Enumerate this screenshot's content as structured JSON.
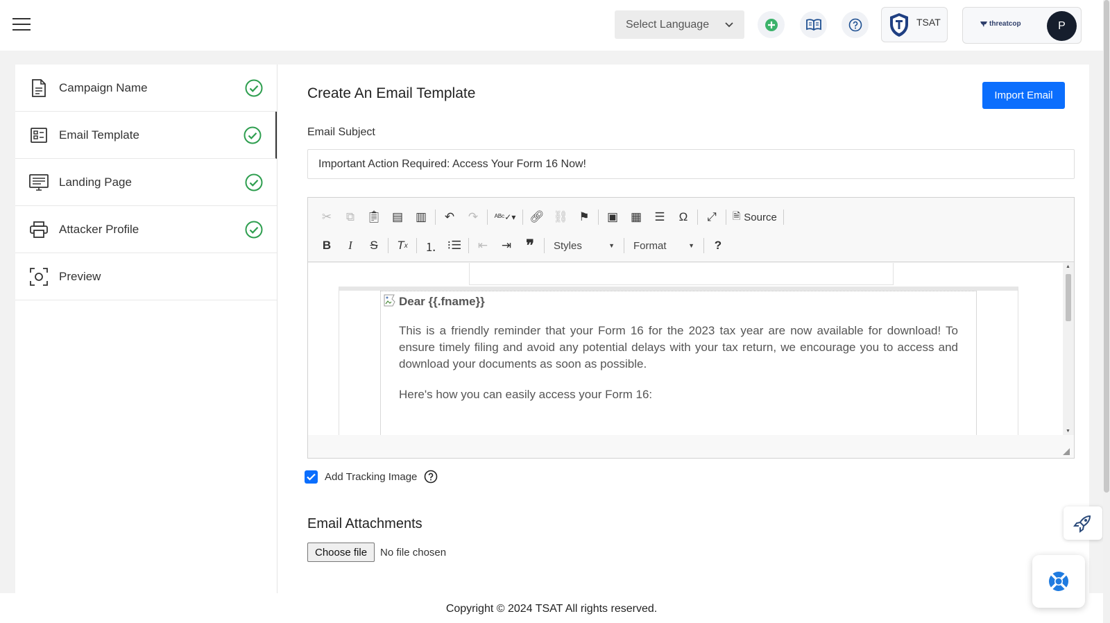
{
  "header": {
    "language_select": "Select Language",
    "tsat_label": "TSAT",
    "brand_logo_text": "threatcop",
    "avatar_initial": "P"
  },
  "sidebar": {
    "items": [
      {
        "label": "Campaign Name",
        "icon": "document-icon",
        "completed": true
      },
      {
        "label": "Email Template",
        "icon": "template-icon",
        "completed": true
      },
      {
        "label": "Landing Page",
        "icon": "monitor-icon",
        "completed": true
      },
      {
        "label": "Attacker Profile",
        "icon": "printer-icon",
        "completed": true
      },
      {
        "label": "Preview",
        "icon": "preview-camera-icon",
        "completed": false
      }
    ]
  },
  "main": {
    "title": "Create An Email Template",
    "import_button": "Import Email",
    "subject_label": "Email Subject",
    "subject_value": "Important Action Required: Access Your Form 16 Now!",
    "editor": {
      "source_label": "Source",
      "styles_label": "Styles",
      "format_label": "Format",
      "help_label": "?",
      "body": {
        "greeting": "Dear {{.fname}}",
        "paragraph1": "This is a friendly reminder that your Form 16 for the 2023 tax year are now available for download! To ensure timely filing and avoid any potential delays with your tax return, we encourage you to access and download your documents as soon as possible.",
        "paragraph2": "Here's how you can easily access your Form 16:"
      }
    },
    "tracking_label": "Add Tracking Image",
    "tracking_checked": true,
    "attachments_title": "Email Attachments",
    "choose_file": "Choose file",
    "no_file": "No file chosen"
  },
  "footer": {
    "copyright": "Copyright © 2024 TSAT All rights reserved."
  },
  "colors": {
    "primary": "#0b6efd",
    "success": "#2e9e4f",
    "avatar_bg": "#161e2d"
  }
}
